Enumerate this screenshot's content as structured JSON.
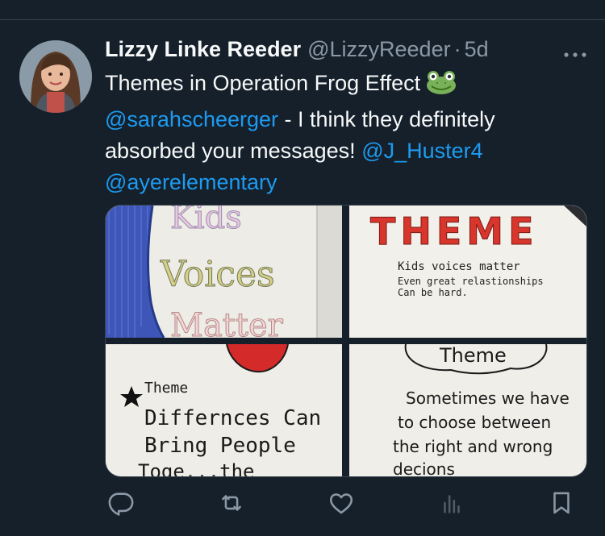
{
  "tweet": {
    "author_name": "Lizzy Linke Reeder",
    "handle": "@LizzyReeder",
    "separator": "·",
    "time": "5d",
    "text_line1": "Themes in Operation Frog Effect",
    "emoji": "frog",
    "mention1": "@sarahscheerger",
    "text_line2_rest": " - I think they definitely",
    "text_line3": "absorbed your messages! ",
    "mention2": "@J_Huster4",
    "mention3": "@ayerelementary"
  },
  "media": {
    "img1": {
      "line1": "Kids",
      "line2": "Voices",
      "line3": "Matter"
    },
    "img2": {
      "title": "THEME",
      "line1": "Kids voices matter",
      "line2": "Even great relastionships",
      "line3": "Can be hard."
    },
    "img3": {
      "heading": "Theme",
      "line1": "Differnces Can",
      "line2": "Bring People",
      "line3": "Toge...the"
    },
    "img4": {
      "heading": "Theme",
      "line1": "Sometimes we have",
      "line2": "to choose between",
      "line3": "the right and wrong",
      "line4": "decions"
    }
  },
  "actions": {
    "icons": [
      "reply-icon",
      "retweet-icon",
      "like-icon",
      "views-icon",
      "bookmark-icon"
    ]
  },
  "colors": {
    "background": "#15202b",
    "text": "#f7f9f9",
    "muted": "#8b98a5",
    "link": "#1d9bf0",
    "border": "#38444d"
  }
}
